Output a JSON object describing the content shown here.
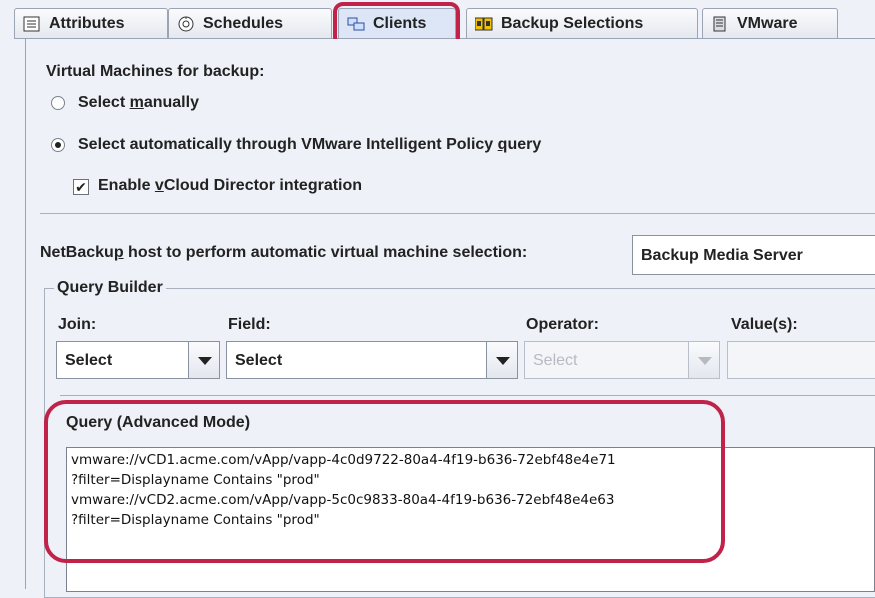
{
  "tabs": [
    {
      "label": "Attributes",
      "icon": "attributes-icon"
    },
    {
      "label": "Schedules",
      "icon": "schedules-icon"
    },
    {
      "label": "Clients",
      "icon": "clients-icon",
      "active": true
    },
    {
      "label": "Backup Selections",
      "icon": "backup-selections-icon"
    },
    {
      "label": "VMware",
      "icon": "vmware-icon"
    }
  ],
  "vm_section": {
    "title": "Virtual Machines for backup:",
    "option_manual_pre": "Select ",
    "option_manual_mn": "m",
    "option_manual_post": "anually",
    "option_auto_pre": "Select automatically through VMware Intelligent Policy ",
    "option_auto_mn": "q",
    "option_auto_post": "uery",
    "selected_option": "auto",
    "vcloud_pre": "Enable ",
    "vcloud_mn": "v",
    "vcloud_post": "Cloud Director integration",
    "vcloud_checked": true
  },
  "host": {
    "label_pre": "NetBacku",
    "label_mn": "p",
    "label_post": " host to perform automatic virtual machine selection:",
    "value": "Backup Media Server"
  },
  "query_builder": {
    "title": "Query Builder",
    "join_label": "Join:",
    "field_label": "Field:",
    "operator_label": "Operator:",
    "values_label": "Value(s):",
    "join_value": "Select",
    "field_value": "Select",
    "operator_value": "Select"
  },
  "advanced": {
    "title": "Query (Advanced Mode)",
    "query_text": "vmware://vCD1.acme.com/vApp/vapp-4c0d9722-80a4-4f19-b636-72ebf48e4e71\n?filter=Displayname Contains \"prod\"\nvmware://vCD2.acme.com/vApp/vapp-5c0c9833-80a4-4f19-b636-72ebf48e4e63\n?filter=Displayname Contains \"prod\""
  },
  "colors": {
    "highlight": "#c0224a",
    "background": "#eef1f7"
  }
}
